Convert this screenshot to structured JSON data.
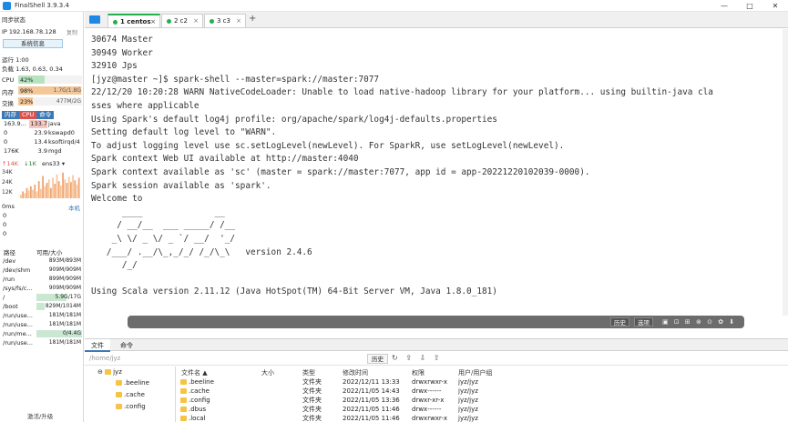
{
  "app": {
    "title": "FinalShell 3.9.3.4",
    "win_min": "—",
    "win_max": "□",
    "win_close": "✕"
  },
  "sidebar": {
    "sync_status": "同步状态",
    "ip": "IP 192.168.78.128",
    "copy": "复制",
    "sysinfo_btn": "系统信息",
    "uptime": "运行 1:00",
    "load": "负载 1.63, 0.63, 0.34",
    "meters": [
      {
        "label": "CPU",
        "pct": "42%",
        "value": "",
        "fraction": 0.42,
        "color": "#b7e2c0"
      },
      {
        "label": "内存",
        "pct": "98%",
        "value": "1.7G/1.8G",
        "fraction": 0.98,
        "color": "#f4c79a"
      },
      {
        "label": "交换",
        "pct": "23%",
        "value": "477M/2G",
        "fraction": 0.23,
        "color": "#f4c79a"
      }
    ],
    "proc_tabs": [
      "内存",
      "CPU",
      "命令"
    ],
    "processes": [
      {
        "mem": "163.9...",
        "cpu": "133.7",
        "cmd": "java"
      },
      {
        "mem": "0",
        "cpu": "23.9",
        "cmd": "kswapd0"
      },
      {
        "mem": "0",
        "cpu": "13.4",
        "cmd": "ksoftirqd/4"
      },
      {
        "mem": "176K",
        "cpu": "3.9",
        "cmd": "mgd"
      }
    ],
    "net": {
      "up": "↑14K",
      "down": "↓1K",
      "iface": "ens33 ▾"
    },
    "net_axis": [
      "34K",
      "24K",
      "12K"
    ],
    "net_values": [
      4,
      8,
      6,
      12,
      9,
      14,
      10,
      16,
      8,
      20,
      11,
      26,
      14,
      18,
      22,
      12,
      24,
      17,
      28,
      20,
      15,
      30,
      22,
      18,
      25,
      19,
      27,
      21,
      16,
      24
    ],
    "latency": {
      "label": "0ms",
      "host": "本机",
      "values": [
        "0",
        "0",
        "0"
      ]
    },
    "disk_head": {
      "path": "路径",
      "avail": "可用/大小"
    },
    "disks": [
      {
        "path": "/dev",
        "value": "893M/893M",
        "fraction": 0.0
      },
      {
        "path": "/dev/shm",
        "value": "909M/909M",
        "fraction": 0.0
      },
      {
        "path": "/run",
        "value": "899M/909M",
        "fraction": 0.0
      },
      {
        "path": "/sys/fs/c...",
        "value": "909M/909M",
        "fraction": 0.0
      },
      {
        "path": "/",
        "value": "5.9G/17G",
        "fraction": 0.65
      },
      {
        "path": "/boot",
        "value": "829M/1014M",
        "fraction": 0.18
      },
      {
        "path": "/run/use...",
        "value": "181M/181M",
        "fraction": 0.0
      },
      {
        "path": "/run/use...",
        "value": "181M/181M",
        "fraction": 0.0
      },
      {
        "path": "/run/me...",
        "value": "0/4.4G",
        "fraction": 1.0
      },
      {
        "path": "/run/use...",
        "value": "181M/181M",
        "fraction": 0.0
      }
    ],
    "activate": "激活/升级"
  },
  "tabs": [
    {
      "label": "1 centos",
      "close": "×"
    },
    {
      "label": "2 c2",
      "close": "×"
    },
    {
      "label": "3 c3",
      "close": "×"
    }
  ],
  "add_tab": "+",
  "terminal": [
    "30674 Master",
    "30949 Worker",
    "32910 Jps",
    "[jyz@master ~]$ spark-shell --master=spark://master:7077",
    "22/12/20 10:20:28 WARN NativeCodeLoader: Unable to load native-hadoop library for your platform... using builtin-java cla",
    "sses where applicable",
    "Using Spark's default log4j profile: org/apache/spark/log4j-defaults.properties",
    "Setting default log level to \"WARN\".",
    "To adjust logging level use sc.setLogLevel(newLevel). For SparkR, use setLogLevel(newLevel).",
    "Spark context Web UI available at http://master:4040",
    "Spark context available as 'sc' (master = spark://master:7077, app id = app-20221220102039-0000).",
    "Spark session available as 'spark'.",
    "Welcome to",
    "      ____              __",
    "     / __/__  ___ _____/ /__",
    "    _\\ \\/ _ \\/ _ `/ __/  '_/",
    "   /___/ .__/\\_,_/_/ /_/\\_\\   version 2.4.6",
    "      /_/",
    "",
    "Using Scala version 2.11.12 (Java HotSpot(TM) 64-Bit Server VM, Java 1.8.0_181)"
  ],
  "cmdbar": {
    "history": "历史",
    "options": "选项",
    "icons": "▣ ⊡ ⊞ ⊗ ⊙ ✿ ⬇"
  },
  "bottom_tabs": [
    "文件",
    "命令"
  ],
  "pathbar": {
    "path": "/home/jyz",
    "history": "历史",
    "icons": "↻ ⇪ ⇩ ⇧"
  },
  "tree": {
    "root_marker": "⊖",
    "root": "jyz",
    "items": [
      ".beeline",
      ".cache",
      ".config"
    ]
  },
  "files": {
    "headers": [
      "文件名 ▲",
      "大小",
      "类型",
      "修改时间",
      "权限",
      "用户/用户组"
    ],
    "rows": [
      {
        "name": ".beeline",
        "size": "",
        "type": "文件夹",
        "mtime": "2022/12/11 13:33",
        "perm": "drwxrwxr-x",
        "owner": "jyz/jyz"
      },
      {
        "name": ".cache",
        "size": "",
        "type": "文件夹",
        "mtime": "2022/11/05 14:43",
        "perm": "drwx------",
        "owner": "jyz/jyz"
      },
      {
        "name": ".config",
        "size": "",
        "type": "文件夹",
        "mtime": "2022/11/05 13:36",
        "perm": "drwxr-xr-x",
        "owner": "jyz/jyz"
      },
      {
        "name": ".dbus",
        "size": "",
        "type": "文件夹",
        "mtime": "2022/11/05 11:46",
        "perm": "drwx------",
        "owner": "jyz/jyz"
      },
      {
        "name": ".local",
        "size": "",
        "type": "文件夹",
        "mtime": "2022/11/05 11:46",
        "perm": "drwxrwxr-x",
        "owner": "jyz/jyz"
      }
    ]
  }
}
